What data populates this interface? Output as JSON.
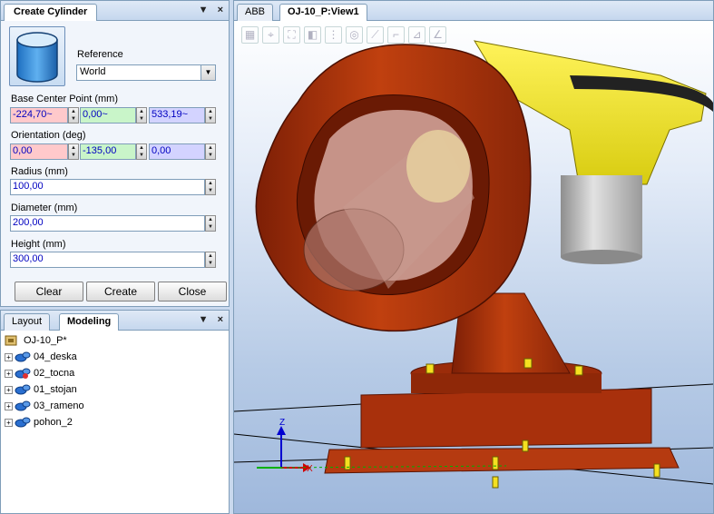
{
  "create_panel": {
    "title": "Create Cylinder",
    "dropdown_icon": "▼",
    "close_icon": "×",
    "reference_label": "Reference",
    "reference_value": "World",
    "base_center_label": "Base Center Point (mm)",
    "base_x": "-224,70~",
    "base_y": "0,00~",
    "base_z": "533,19~",
    "orientation_label": "Orientation (deg)",
    "orient_x": "0,00",
    "orient_y": "-135,00",
    "orient_z": "0,00",
    "radius_label": "Radius (mm)",
    "radius_value": "100,00",
    "diameter_label": "Diameter (mm)",
    "diameter_value": "200,00",
    "height_label": "Height (mm)",
    "height_value": "300,00",
    "clear_label": "Clear",
    "create_label": "Create",
    "close_label": "Close"
  },
  "browser_panel": {
    "tab_layout": "Layout",
    "tab_modeling": "Modeling",
    "root_label": "OJ-10_P*",
    "items": [
      {
        "label": "04_deska"
      },
      {
        "label": "02_tocna"
      },
      {
        "label": "01_stojan"
      },
      {
        "label": "03_rameno"
      },
      {
        "label": "pohon_2"
      }
    ]
  },
  "view": {
    "tab_abb": "ABB",
    "tab_view": "OJ-10_P:View1",
    "axis_z": "Z",
    "axis_x": "X"
  },
  "colors": {
    "robot_red": "#b5340f",
    "robot_dark": "#7a1e08",
    "yellow": "#f2e81b",
    "gray": "#c8c8c8"
  }
}
